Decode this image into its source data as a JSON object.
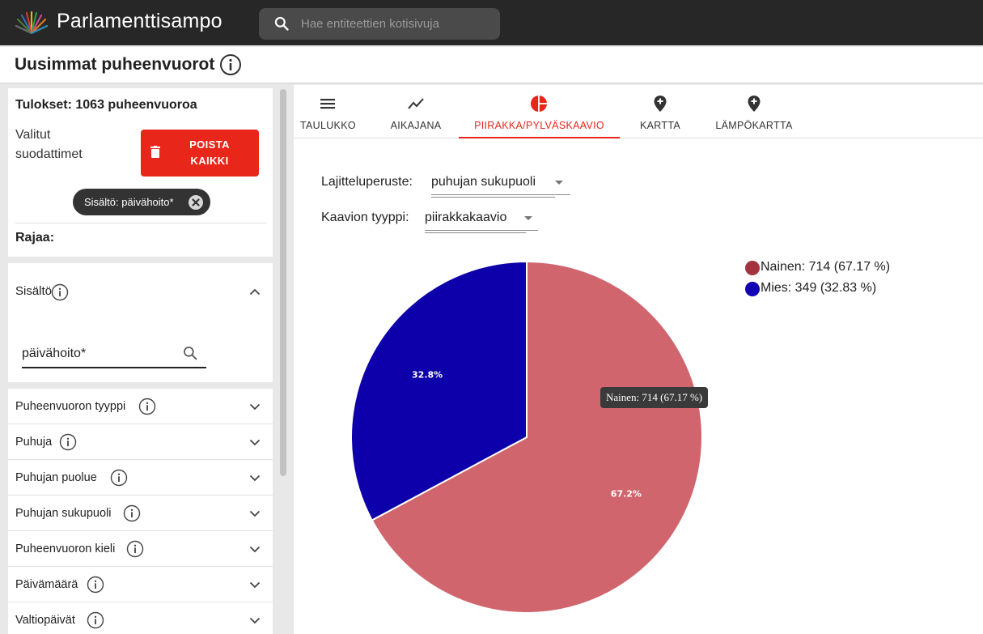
{
  "app": {
    "title": "Parlamenttisampo",
    "search_placeholder": "Hae entiteettien kotisivuja"
  },
  "page": {
    "title": "Uusimmat puheenvuorot"
  },
  "sidebar": {
    "results_title": "Tulokset: 1063 puheenvuoroa",
    "selected_filters_label": "Valitut suodattimet",
    "clear_all_label": "POISTA KAIKKI",
    "chip_label": "Sisältö: päivähoito*",
    "refine_label": "Rajaa:",
    "content_facet": {
      "label": "Sisältö",
      "input_value": "päivähoito*"
    },
    "facets": [
      {
        "label": "Puheenvuoron tyyppi"
      },
      {
        "label": "Puhuja"
      },
      {
        "label": "Puhujan puolue"
      },
      {
        "label": "Puhujan sukupuoli"
      },
      {
        "label": "Puheenvuoron kieli"
      },
      {
        "label": "Päivämäärä"
      },
      {
        "label": "Valtiopäivät"
      }
    ]
  },
  "tabs": [
    {
      "label": "TAULUKKO",
      "icon": "list-icon"
    },
    {
      "label": "AIKAJANA",
      "icon": "timeline-icon"
    },
    {
      "label": "PIIRAKKA/PYLVÄSKAAVIO",
      "icon": "pie-chart-icon",
      "active": true
    },
    {
      "label": "KARTTA",
      "icon": "map-pin-icon"
    },
    {
      "label": "LÄMPÖKARTTA",
      "icon": "map-pin-icon"
    }
  ],
  "controls": {
    "grouping_label": "Lajitteluperuste:",
    "grouping_value": "puhujan sukupuoli",
    "chart_type_label": "Kaavion tyyppi:",
    "chart_type_value": "piirakkakaavio"
  },
  "colors": {
    "accent": "#e8261a",
    "appbar": "#272727"
  },
  "chart_data": {
    "type": "pie",
    "slices": [
      {
        "label": "Nainen",
        "count": 714,
        "percent": 67.17,
        "data_label": "67.2%",
        "legend": "Nainen: 714 (67.17 %)",
        "color": "#d0656d",
        "legend_color": "#a3343f"
      },
      {
        "label": "Mies",
        "count": 349,
        "percent": 32.83,
        "data_label": "32.8%",
        "legend": "Mies: 349 (32.83 %)",
        "color": "#0d00aa",
        "legend_color": "#1200b5"
      }
    ],
    "tooltip": "Nainen: 714 (67.17 %)",
    "legend_position": "top-right"
  }
}
